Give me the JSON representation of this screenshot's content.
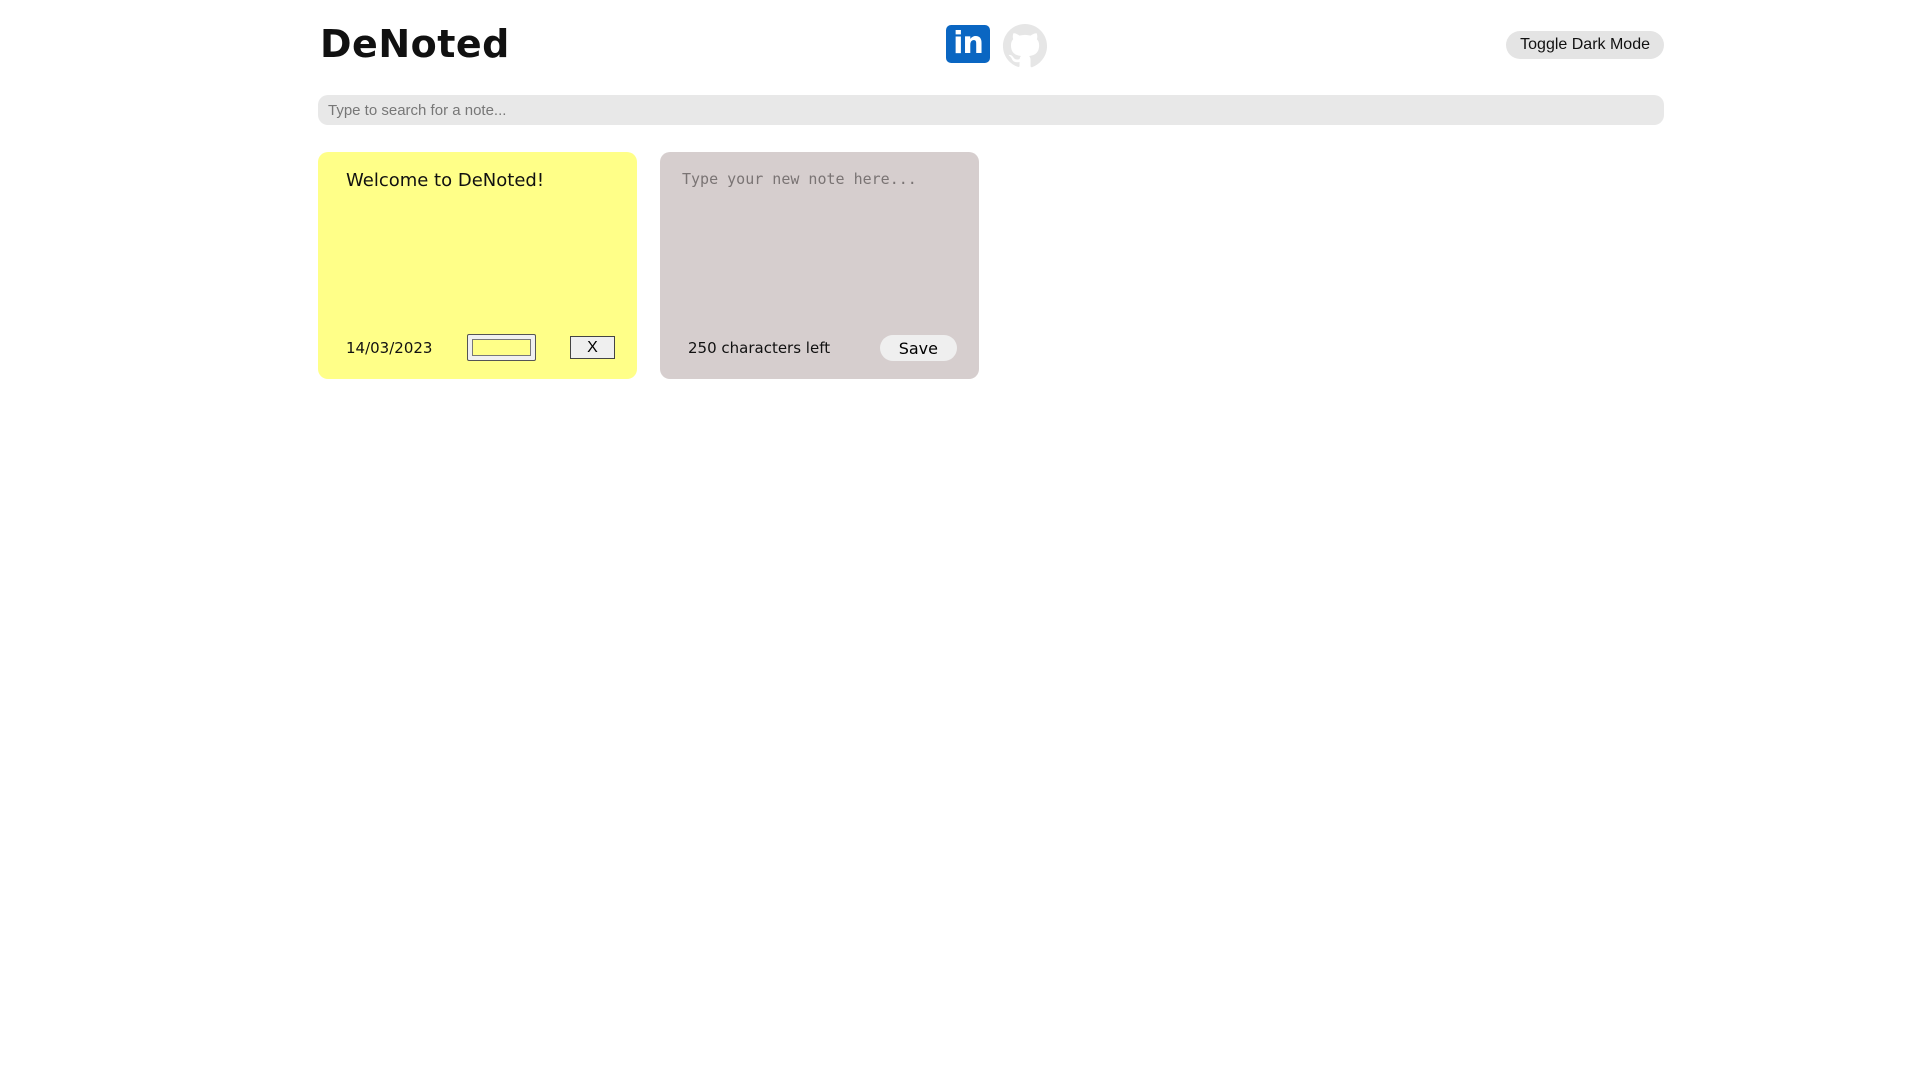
{
  "header": {
    "title": "DeNoted",
    "linkedin_glyph": "in",
    "toggle_label": "Toggle Dark Mode"
  },
  "search": {
    "placeholder": "Type to search for a note...",
    "value": ""
  },
  "notes": [
    {
      "text": "Welcome to DeNoted!",
      "date": "14/03/2023",
      "color": "#ffff88",
      "delete_label": "X"
    }
  ],
  "new_note": {
    "placeholder": "Type your new note here...",
    "chars_left": "250 characters left",
    "save_label": "Save"
  },
  "icons": [
    "linkedin-icon",
    "github-icon"
  ],
  "colors": {
    "note_yellow": "#ffff88",
    "new_note_bg": "#d6cece",
    "linkedin": "#0a66c2",
    "github": "#e6e6e6"
  }
}
